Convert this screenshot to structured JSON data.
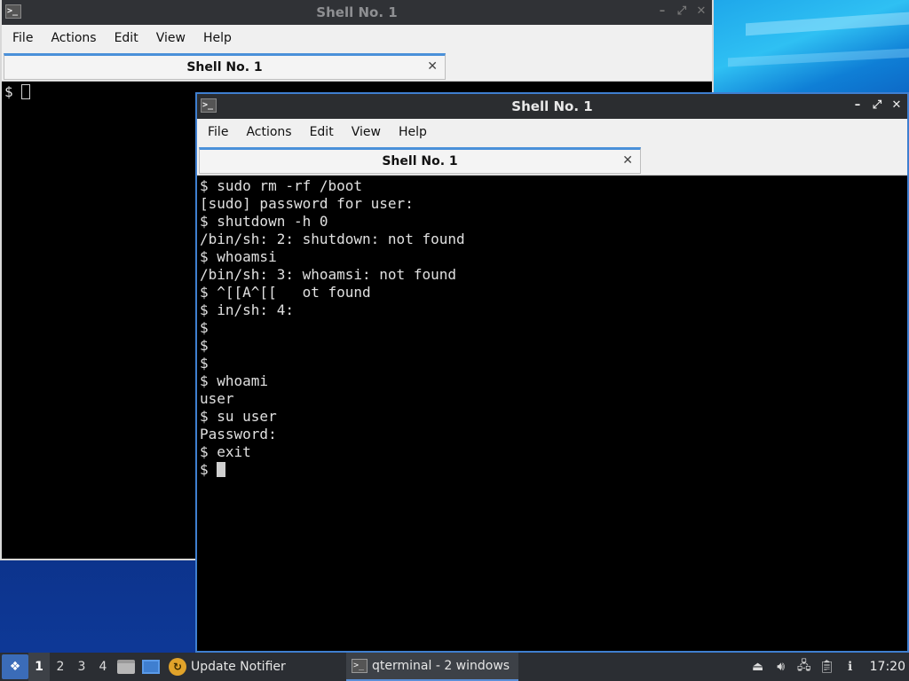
{
  "desktop": {},
  "back_window": {
    "title": "Shell No. 1",
    "menu": [
      "File",
      "Actions",
      "Edit",
      "View",
      "Help"
    ],
    "tab_label": "Shell No. 1",
    "terminal_lines": [
      "$ "
    ]
  },
  "front_window": {
    "title": "Shell No. 1",
    "menu": [
      "File",
      "Actions",
      "Edit",
      "View",
      "Help"
    ],
    "tab_label": "Shell No. 1",
    "terminal_lines": [
      "$ sudo rm -rf /boot",
      "[sudo] password for user:",
      "$ shutdown -h 0",
      "/bin/sh: 2: shutdown: not found",
      "$ whoamsi",
      "/bin/sh: 3: whoamsi: not found",
      "$ ^[[A^[[   ot found",
      "$ in/sh: 4:",
      "$",
      "$",
      "$",
      "$ whoami",
      "user",
      "$ su user",
      "Password:",
      "$ exit",
      "$ "
    ]
  },
  "taskbar": {
    "workspaces": [
      "1",
      "2",
      "3",
      "4"
    ],
    "active_workspace": "1",
    "update_notifier_label": "Update Notifier",
    "terminal_task_label": "qterminal - 2 windows",
    "clock": "17:20",
    "icons": {
      "start": "start-menu-icon",
      "files": "file-manager-icon",
      "desktop": "show-desktop-icon",
      "notifier": "update-notifier-icon",
      "terminal": "terminal-icon",
      "tray": [
        "eject-icon",
        "volume-icon",
        "network-icon",
        "clipboard-icon",
        "notification-icon"
      ]
    }
  }
}
